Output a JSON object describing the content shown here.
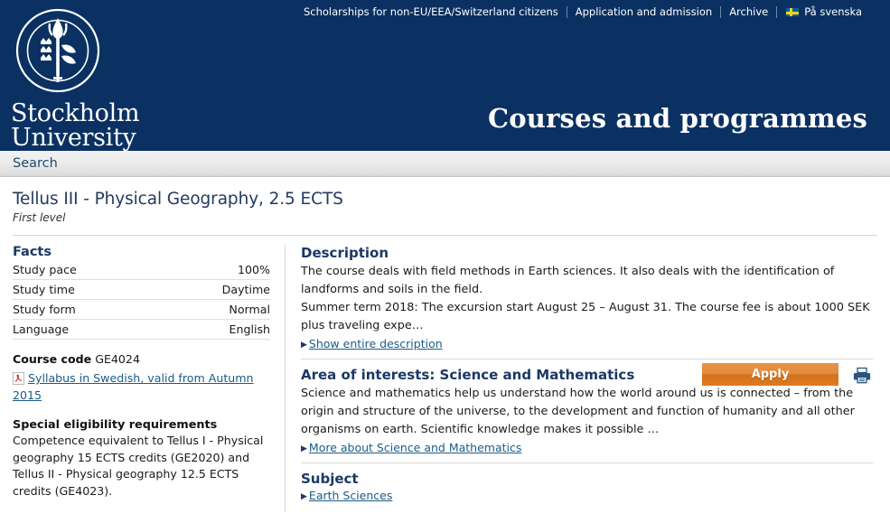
{
  "header": {
    "topnav": [
      {
        "label": "Scholarships for non-EU/EEA/Switzerland citizens"
      },
      {
        "label": "Application and admission"
      },
      {
        "label": "Archive"
      },
      {
        "label": "På svenska"
      }
    ],
    "logo_line1": "Stockholm",
    "logo_line2": "University",
    "logo_emblem_name": "stockholm-university-seal",
    "site_title": "Courses and programmes"
  },
  "searchbar": {
    "search_label": "Search"
  },
  "page": {
    "course_title": "Tellus III - Physical Geography, 2.5 ECTS",
    "course_level": "First level",
    "apply_label": "Apply",
    "print_icon": "printer-icon"
  },
  "facts": {
    "heading": "Facts",
    "rows": [
      {
        "label": "Study pace",
        "value": "100%"
      },
      {
        "label": "Study time",
        "value": "Daytime"
      },
      {
        "label": "Study form",
        "value": "Normal"
      },
      {
        "label": "Language",
        "value": "English"
      }
    ],
    "course_code_label": "Course code",
    "course_code_value": "GE4024",
    "syllabus_link": "Syllabus in Swedish, valid from Autumn 2015",
    "pdf_icon": "pdf-file-icon"
  },
  "eligibility": {
    "heading": "Special eligibility requirements",
    "text": "Competence equivalent to Tellus I - Physical geography 15 ECTS credits (GE2020) and Tellus II - Physical geography 12.5 ECTS credits (GE4023)."
  },
  "description": {
    "heading": "Description",
    "paragraph1": "The course deals with field methods in Earth sciences. It also deals with the identification of landforms and soils in the field.",
    "paragraph2": "Summer term 2018: The excursion start August 25 – August 31. The course fee is about 1000 SEK plus traveling expe…",
    "link": "Show entire description"
  },
  "area_of_interest": {
    "heading": "Area of interests: Science and Mathematics",
    "text": "Science and mathematics help us understand how the world around us is connected – from the origin and structure of the universe, to the development and function of humanity and all other organisms on earth. Scientific knowledge makes it possible …",
    "link": "More about Science and Mathematics"
  },
  "subject": {
    "heading": "Subject",
    "link": "Earth Sciences"
  },
  "colors": {
    "navy": "#0a3161",
    "apply_orange": "#d4701a",
    "link_blue": "#1c5c86",
    "heading_blue": "#1b3865"
  }
}
